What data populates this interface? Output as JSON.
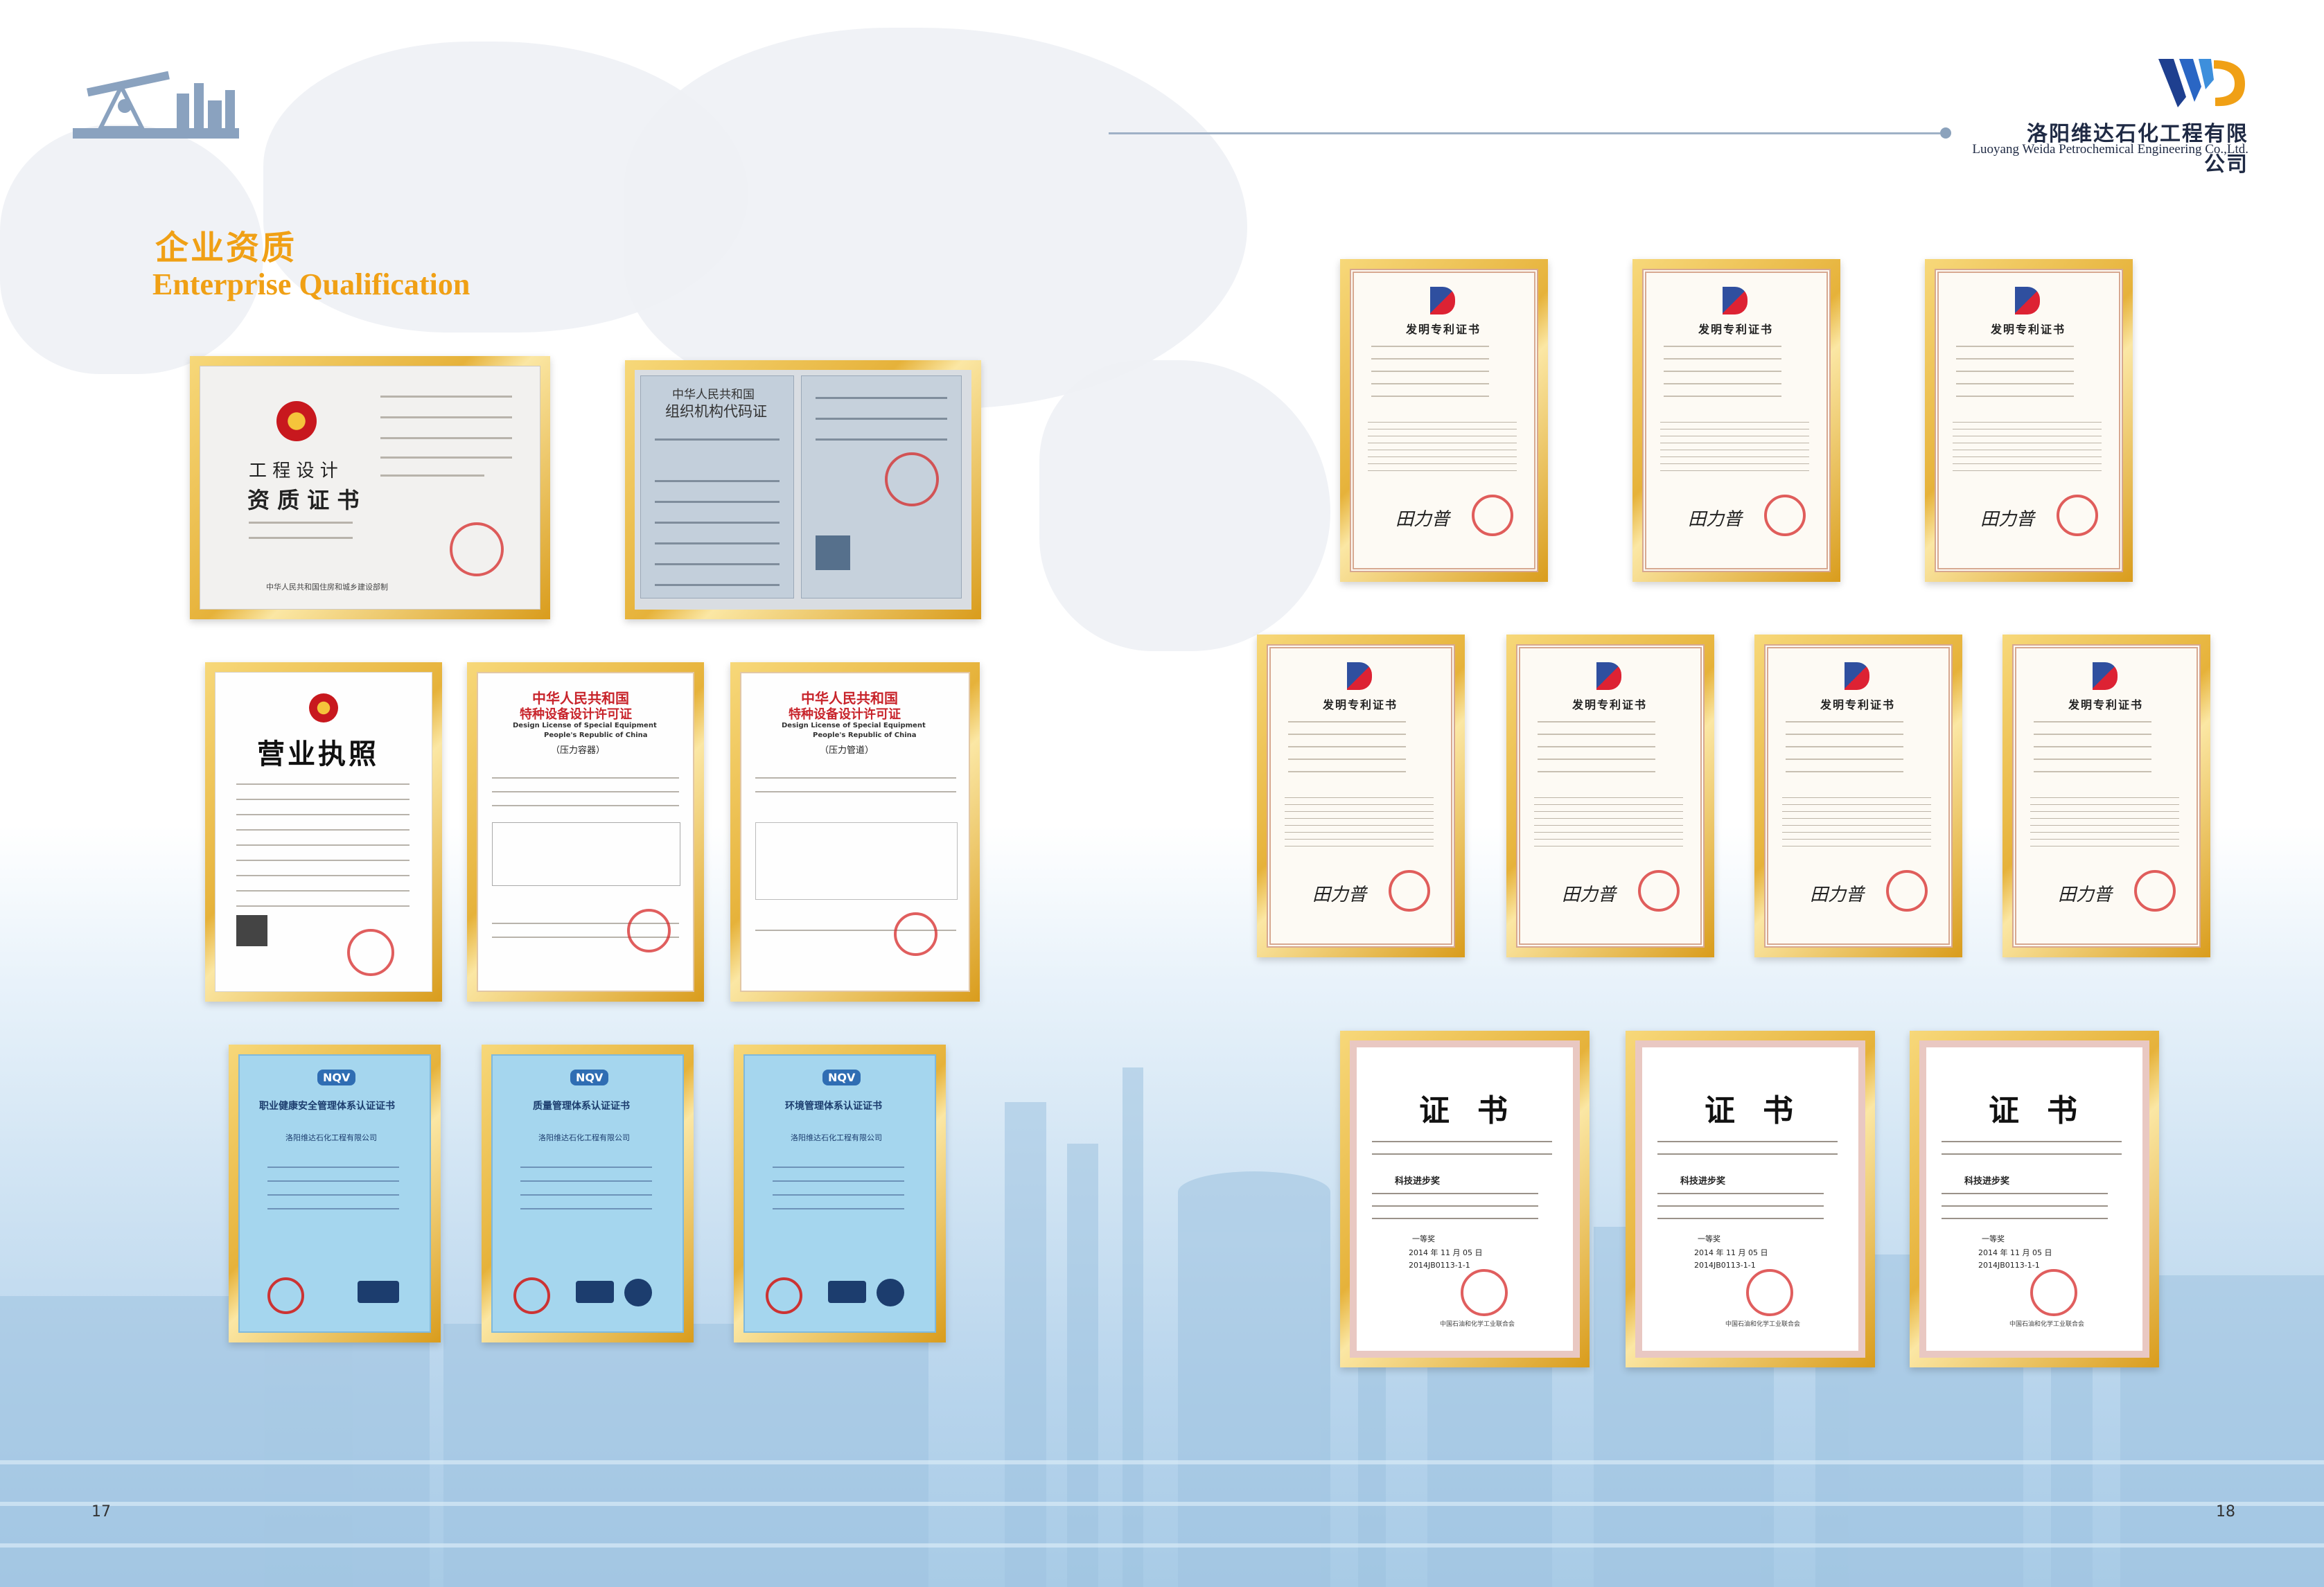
{
  "header": {
    "company_cn": "洛阳维达石化工程有限公司",
    "company_en": "Luoyang Weida Petrochemical Engineering Co.,Ltd.",
    "logo_icon": "wd-logo-icon"
  },
  "section": {
    "title_cn": "企业资质",
    "title_en": "Enterprise Qualification"
  },
  "pages": {
    "left": "17",
    "right": "18"
  },
  "certificates": {
    "engineering": {
      "line1": "工 程 设 计",
      "line2": "资 质 证 书",
      "issuer": "中华人民共和国住房和城乡建设部制"
    },
    "org_code": {
      "title1": "中华人民共和国",
      "title2": "组织机构代码证"
    },
    "business": {
      "title": "营业执照"
    },
    "special_vessel": {
      "title1": "中华人民共和国",
      "title2": "特种设备设计许可证",
      "en1": "Design License of Special Equipment",
      "en2": "People's Republic of China",
      "sub": "（压力容器）"
    },
    "special_pipe": {
      "title1": "中华人民共和国",
      "title2": "特种设备设计许可证",
      "en1": "Design License of Special Equipment",
      "en2": "People's Republic of China",
      "sub": "（压力管道）"
    },
    "iso": [
      {
        "title": "职业健康安全管理体系认证证书",
        "logo": "NQV",
        "company": "洛阳维达石化工程有限公司"
      },
      {
        "title": "质量管理体系认证证书",
        "logo": "NQV",
        "company": "洛阳维达石化工程有限公司"
      },
      {
        "title": "环境管理体系认证证书",
        "logo": "NQV",
        "company": "洛阳维达石化工程有限公司"
      }
    ],
    "patent_title": "发明专利证书",
    "patent_count": 7,
    "award": {
      "title": "证书",
      "prize": "科技进步奖",
      "grade": "一等奖",
      "date": "2014 年 11 月 05 日",
      "cert_no": "2014JB0113-1-1",
      "issuer": "中国石油和化学工业联合会"
    }
  }
}
